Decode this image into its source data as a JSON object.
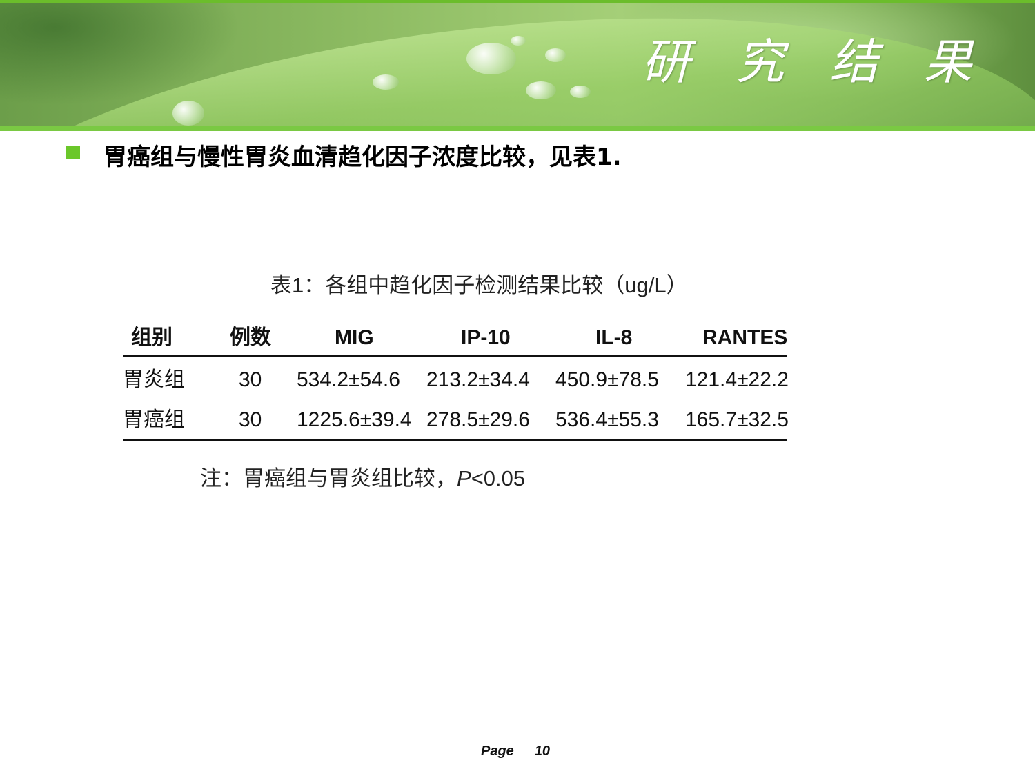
{
  "header": {
    "title": "研 究 结 果"
  },
  "bullet": {
    "text": "胃癌组与慢性胃炎血清趋化因子浓度比较，见表1."
  },
  "table": {
    "caption": "表1：各组中趋化因子检测结果比较（ug/L）",
    "columns": [
      "组别",
      "例数",
      "MIG",
      "IP-10",
      "IL-8",
      "RANTES"
    ],
    "rows": [
      [
        "胃炎组",
        "30",
        "534.2±54.6",
        "213.2±34.4",
        "450.9±78.5",
        "121.4±22.2"
      ],
      [
        "胃癌组",
        "30",
        "1225.6±39.4",
        "278.5±29.6",
        "536.4±55.3",
        "165.7±32.5"
      ]
    ],
    "note_prefix": "注：胃癌组与胃炎组比较，",
    "note_p": "P",
    "note_suffix": "<0.05"
  },
  "footer": {
    "page_label": "Page",
    "page_number": "10"
  },
  "colors": {
    "accent": "#6bc72a",
    "banner_green": "#8dbb62"
  }
}
